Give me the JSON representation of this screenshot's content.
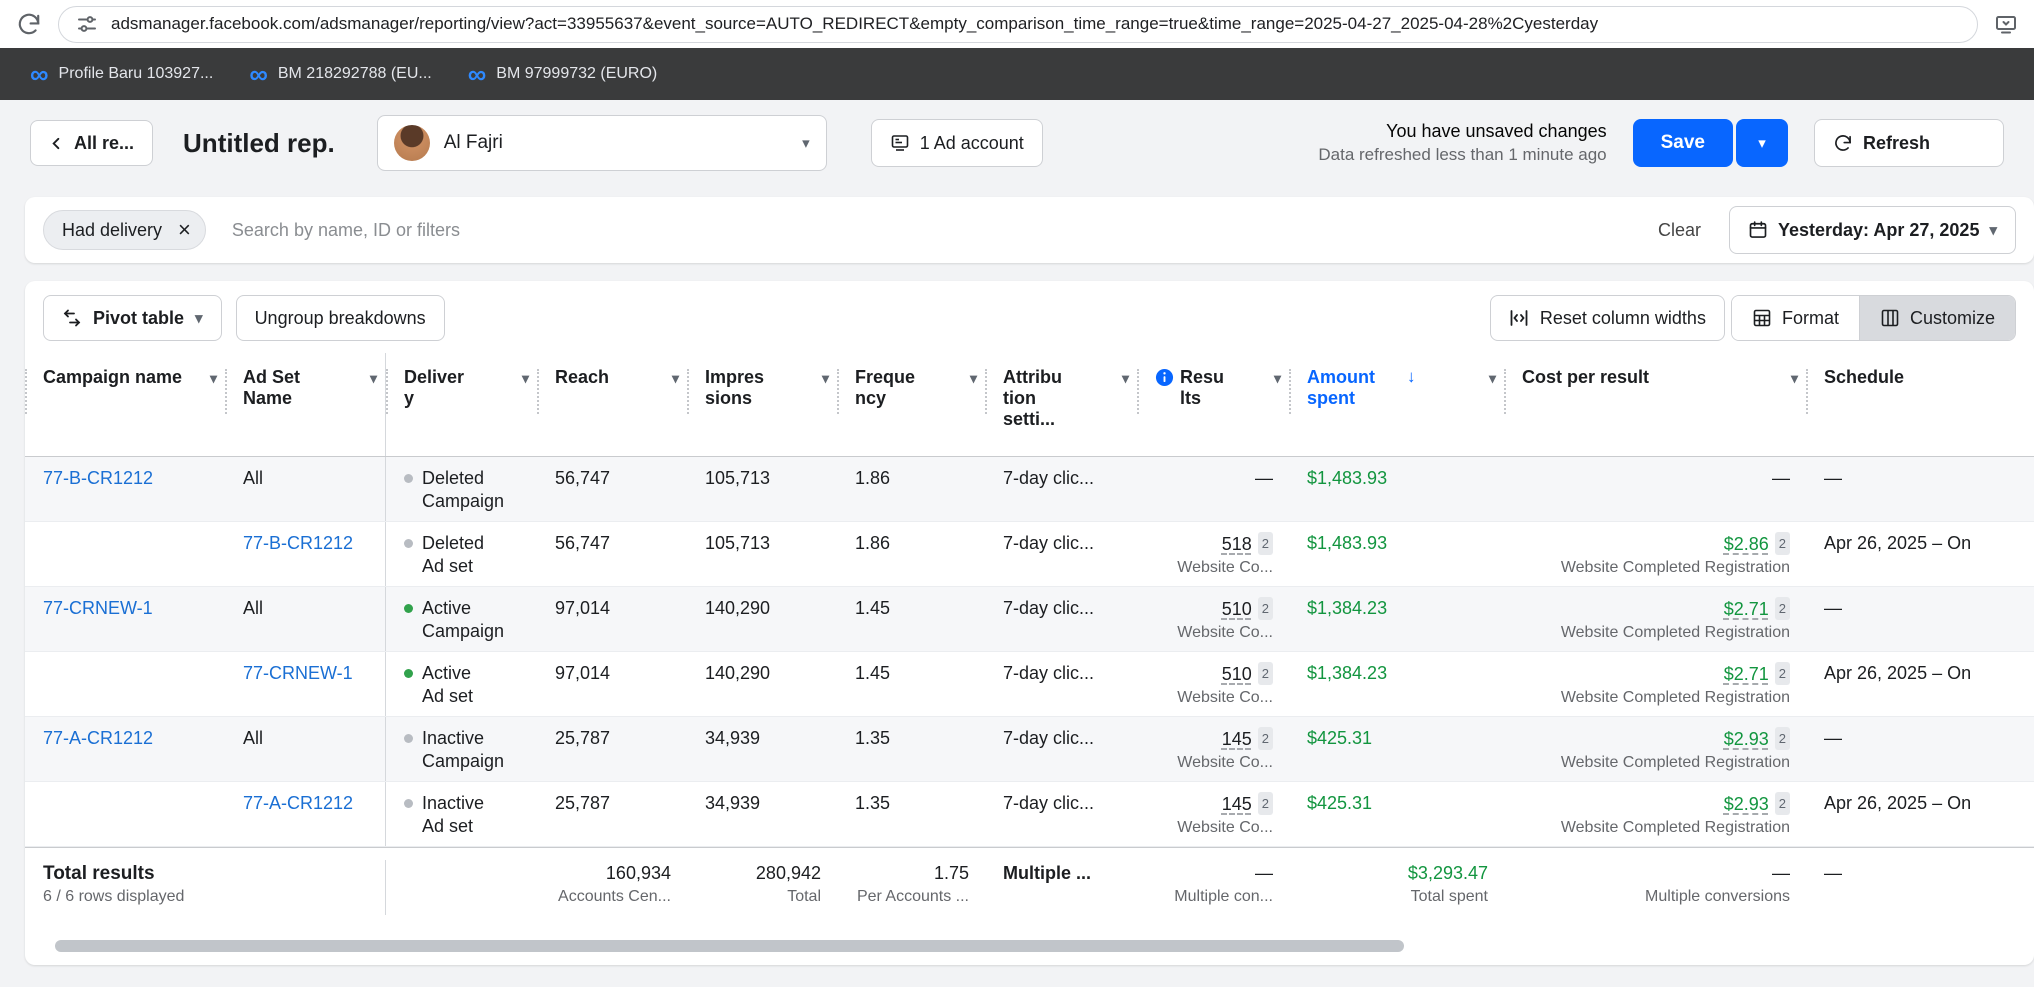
{
  "colors": {
    "accent_blue": "#0866ff",
    "link_blue": "#1a6fd4",
    "money_green": "#12953f",
    "active_dot_green": "#31a24c",
    "inactive_dot_gray": "#b8bcc2",
    "dark_strip": "#3a3b3c"
  },
  "icons": {
    "meta_logo": "∞",
    "caret_down": "▾",
    "sort_desc": "↓",
    "close": "×"
  },
  "browser": {
    "url": "adsmanager.facebook.com/adsmanager/reporting/view?act=33955637&event_source=AUTO_REDIRECT&empty_comparison_time_range=true&time_range=2025-04-27_2025-04-28%2Cyesterday"
  },
  "workspace_tabs": [
    {
      "label": "Profile Baru 103927..."
    },
    {
      "label": "BM 218292788 (EU..."
    },
    {
      "label": "BM 97999732 (EURO)"
    }
  ],
  "header": {
    "back_label": "All re...",
    "title": "Untitled rep.",
    "account_name": "Al Fajri",
    "ad_account_button": "1 Ad account",
    "unsaved_line1": "You have unsaved changes",
    "unsaved_line2": "Data refreshed less than 1 minute ago",
    "save_label": "Save",
    "refresh_label": "Refresh"
  },
  "filters": {
    "chip": "Had delivery",
    "search_placeholder": "Search by name, ID or filters",
    "clear_label": "Clear",
    "date_range": "Yesterday: Apr 27, 2025"
  },
  "toolbar": {
    "pivot": "Pivot table",
    "ungroup": "Ungroup breakdowns",
    "reset_columns": "Reset column widths",
    "format": "Format",
    "customize": "Customize"
  },
  "table": {
    "columns": [
      {
        "label": "Campaign name"
      },
      {
        "label": "Ad Set Name"
      },
      {
        "label": "Delivery"
      },
      {
        "label": "Reach"
      },
      {
        "label": "Impressions"
      },
      {
        "label": "Frequency"
      },
      {
        "label": "Attribution setti..."
      },
      {
        "label": "Results"
      },
      {
        "label": "Amount spent"
      },
      {
        "label": "Cost per result"
      },
      {
        "label": "Schedule"
      }
    ],
    "rows": [
      {
        "campaign": "77-B-CR1212",
        "campaign_class": "cell-link",
        "adset": "All",
        "adset_class": "",
        "status": "Deleted",
        "level": "Campaign",
        "dot": "dot-gray",
        "reach": "56,747",
        "impressions": "105,713",
        "frequency": "1.86",
        "attribution": "7-day clic...",
        "results_value": "—",
        "results_u": "",
        "results_badge": "",
        "results_sub": "",
        "spent": "$1,483.93",
        "cost_value": "—",
        "cost_u": "",
        "cost_badge": "",
        "cost_sub": "",
        "schedule": "—"
      },
      {
        "campaign": "",
        "campaign_class": "",
        "adset": "77-B-CR1212",
        "adset_class": "cell-link",
        "status": "Deleted",
        "level": "Ad set",
        "dot": "dot-gray",
        "reach": "56,747",
        "impressions": "105,713",
        "frequency": "1.86",
        "attribution": "7-day clic...",
        "results_value": "518",
        "results_u": "u",
        "results_badge": "2",
        "results_sub": "Website Co...",
        "spent": "$1,483.93",
        "cost_value": "$2.86",
        "cost_u": "money u",
        "cost_badge": "2",
        "cost_sub": "Website Completed Registration",
        "schedule": "Apr 26, 2025 – On"
      },
      {
        "campaign": "77-CRNEW-1",
        "campaign_class": "cell-link",
        "adset": "All",
        "adset_class": "",
        "status": "Active",
        "level": "Campaign",
        "dot": "dot-green",
        "reach": "97,014",
        "impressions": "140,290",
        "frequency": "1.45",
        "attribution": "7-day clic...",
        "results_value": "510",
        "results_u": "u",
        "results_badge": "2",
        "results_sub": "Website Co...",
        "spent": "$1,384.23",
        "cost_value": "$2.71",
        "cost_u": "money u",
        "cost_badge": "2",
        "cost_sub": "Website Completed Registration",
        "schedule": "—"
      },
      {
        "campaign": "",
        "campaign_class": "",
        "adset": "77-CRNEW-1",
        "adset_class": "cell-link",
        "status": "Active",
        "level": "Ad set",
        "dot": "dot-green",
        "reach": "97,014",
        "impressions": "140,290",
        "frequency": "1.45",
        "attribution": "7-day clic...",
        "results_value": "510",
        "results_u": "u",
        "results_badge": "2",
        "results_sub": "Website Co...",
        "spent": "$1,384.23",
        "cost_value": "$2.71",
        "cost_u": "money u",
        "cost_badge": "2",
        "cost_sub": "Website Completed Registration",
        "schedule": "Apr 26, 2025 – On"
      },
      {
        "campaign": "77-A-CR1212",
        "campaign_class": "cell-link",
        "adset": "All",
        "adset_class": "",
        "status": "Inactive",
        "level": "Campaign",
        "dot": "dot-gray",
        "reach": "25,787",
        "impressions": "34,939",
        "frequency": "1.35",
        "attribution": "7-day clic...",
        "results_value": "145",
        "results_u": "u",
        "results_badge": "2",
        "results_sub": "Website Co...",
        "spent": "$425.31",
        "cost_value": "$2.93",
        "cost_u": "money u",
        "cost_badge": "2",
        "cost_sub": "Website Completed Registration",
        "schedule": "—"
      },
      {
        "campaign": "",
        "campaign_class": "",
        "adset": "77-A-CR1212",
        "adset_class": "cell-link",
        "status": "Inactive",
        "level": "Ad set",
        "dot": "dot-gray",
        "reach": "25,787",
        "impressions": "34,939",
        "frequency": "1.35",
        "attribution": "7-day clic...",
        "results_value": "145",
        "results_u": "u",
        "results_badge": "2",
        "results_sub": "Website Co...",
        "spent": "$425.31",
        "cost_value": "$2.93",
        "cost_u": "money u",
        "cost_badge": "2",
        "cost_sub": "Website Completed Registration",
        "schedule": "Apr 26, 2025 – On"
      }
    ],
    "total": {
      "label": "Total results",
      "sub": "6 / 6 rows displayed",
      "reach": "160,934",
      "reach_sub": "Accounts Cen...",
      "impressions": "280,942",
      "impressions_sub": "Total",
      "frequency": "1.75",
      "frequency_sub": "Per Accounts ...",
      "attribution": "Multiple ...",
      "results": "—",
      "results_sub": "Multiple con...",
      "spent": "$3,293.47",
      "spent_sub": "Total spent",
      "cost": "—",
      "cost_sub": "Multiple conversions",
      "schedule": "—"
    }
  }
}
